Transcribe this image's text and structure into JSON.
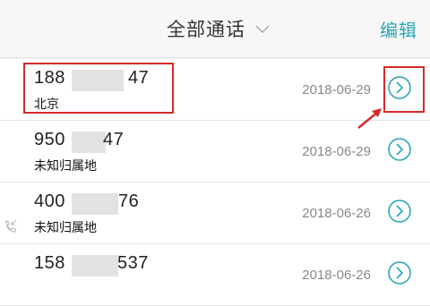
{
  "header": {
    "title": "全部通话",
    "edit_label": "编辑"
  },
  "calls": [
    {
      "number_prefix": "188",
      "number_suffix": "47",
      "location": "北京",
      "date": "2018-06-29"
    },
    {
      "number_prefix": "950",
      "number_suffix": "47",
      "location": "未知归属地",
      "date": "2018-06-29"
    },
    {
      "number_prefix": "400",
      "number_suffix": "76",
      "location": "未知归属地",
      "date": "2018-06-26"
    },
    {
      "number_prefix": "158",
      "number_suffix": "537",
      "location": "",
      "date": "2018-06-26"
    }
  ],
  "icons": {
    "dropdown": "chevron-down-icon",
    "details": "chevron-right-circle-icon",
    "call_type": "incoming-call-icon"
  },
  "colors": {
    "accent": "#2aa6b6",
    "highlight": "#d52a2a",
    "background": "#f4f4f4"
  }
}
